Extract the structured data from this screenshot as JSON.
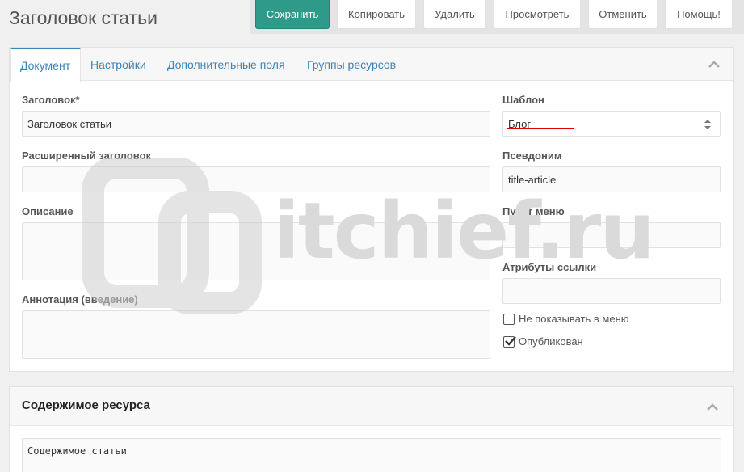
{
  "header": {
    "title": "Заголовок статьи"
  },
  "toolbar": {
    "save": "Сохранить",
    "copy": "Копировать",
    "delete": "Удалить",
    "view": "Просмотреть",
    "cancel": "Отменить",
    "help": "Помощь!"
  },
  "tabs": [
    {
      "label": "Документ",
      "active": true
    },
    {
      "label": "Настройки",
      "active": false
    },
    {
      "label": "Дополнительные поля",
      "active": false
    },
    {
      "label": "Группы ресурсов",
      "active": false
    }
  ],
  "form": {
    "title_label": "Заголовок*",
    "title_value": "Заголовок статьи",
    "longtitle_label": "Расширенный заголовок",
    "longtitle_value": "",
    "description_label": "Описание",
    "description_value": "",
    "introtext_label": "Аннотация (введение)",
    "introtext_value": "",
    "template_label": "Шаблон",
    "template_value": "Блог",
    "alias_label": "Псевдоним",
    "alias_value": "title-article",
    "menutitle_label": "Пункт меню",
    "menutitle_value": "",
    "link_attrs_label": "Атрибуты ссылки",
    "link_attrs_value": "",
    "hidemenu_label": "Не показывать в меню",
    "hidemenu_checked": false,
    "published_label": "Опубликован",
    "published_checked": true
  },
  "content_panel": {
    "title": "Содержимое ресурса",
    "content_value": "Содержимое статьи"
  },
  "watermark": {
    "text": "itchief.ru"
  },
  "colors": {
    "primary": "#2e9a8a",
    "link": "#3a84b8",
    "highlight_underline": "#e00000"
  },
  "icons": [
    "chevron-up-icon",
    "select-arrows-icon",
    "checkmark-icon"
  ]
}
